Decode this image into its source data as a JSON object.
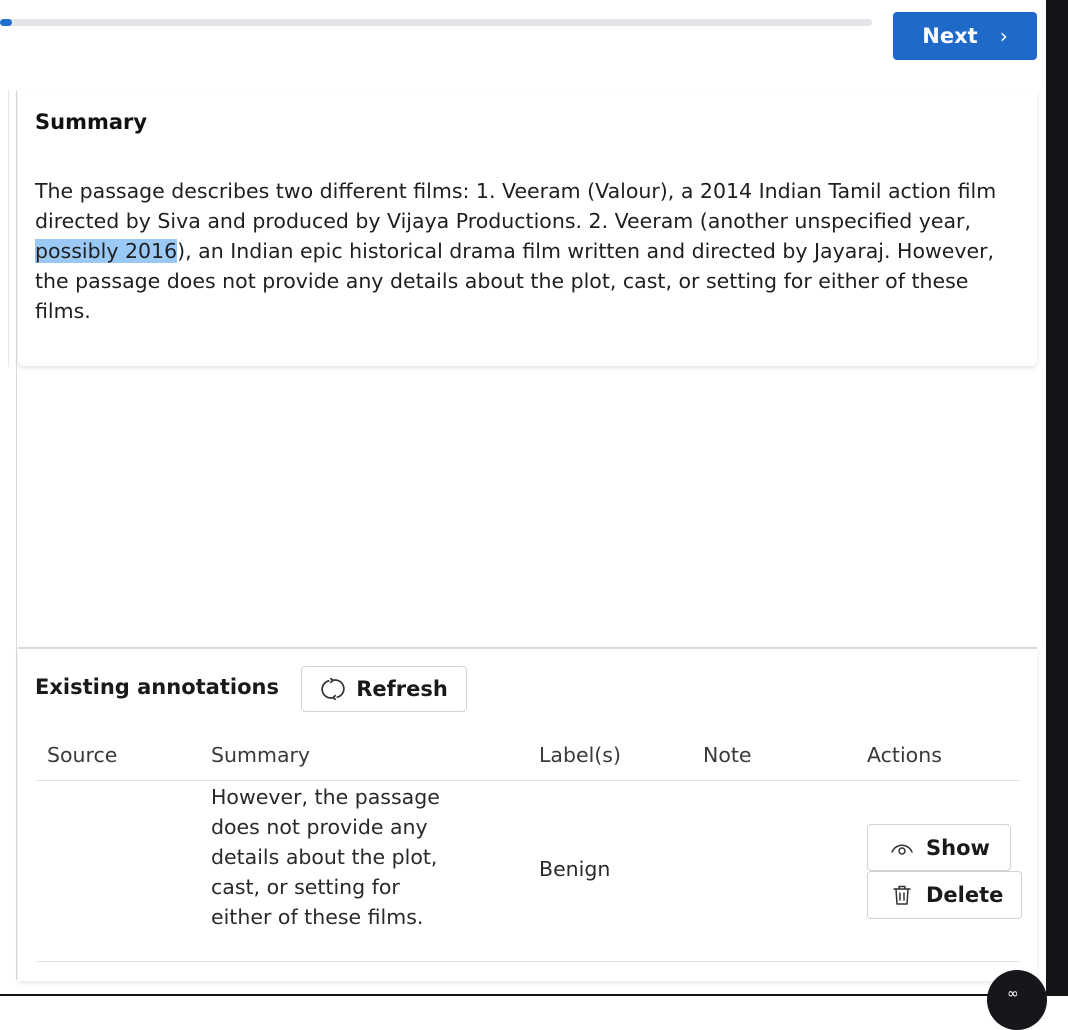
{
  "header": {
    "progress_fraction": 0.014,
    "next_label": "Next",
    "next_icon": "chevron-right-icon",
    "next_chevron": "›"
  },
  "summary": {
    "title": "Summary",
    "text_before": "The passage describes two different films: 1. Veeram (Valour), a 2014 Indian Tamil action film directed by Siva and produced by Vijaya Productions. 2. Veeram (another unspecified year, ",
    "highlighted": "possibly 2016",
    "text_after": "), an Indian epic historical drama film written and directed by Jayaraj. However, the passage does not provide any details about the plot, cast, or setting for either of these films.",
    "highlight_color": "#9bc9f5"
  },
  "annotations": {
    "title": "Existing annotations",
    "refresh_label": "Refresh",
    "refresh_icon": "refresh-icon",
    "columns": [
      "Source",
      "Summary",
      "Label(s)",
      "Note",
      "Actions"
    ],
    "rows": [
      {
        "source": "",
        "summary": "However, the passage does not provide any details about the plot, cast, or setting for either of these films.",
        "labels": "Benign",
        "note": "",
        "actions": {
          "show_label": "Show",
          "show_icon": "eye-icon",
          "delete_label": "Delete",
          "delete_icon": "trash-icon"
        }
      }
    ]
  },
  "colors": {
    "primary": "#1f6ac8",
    "scrollbar": "#121417"
  }
}
